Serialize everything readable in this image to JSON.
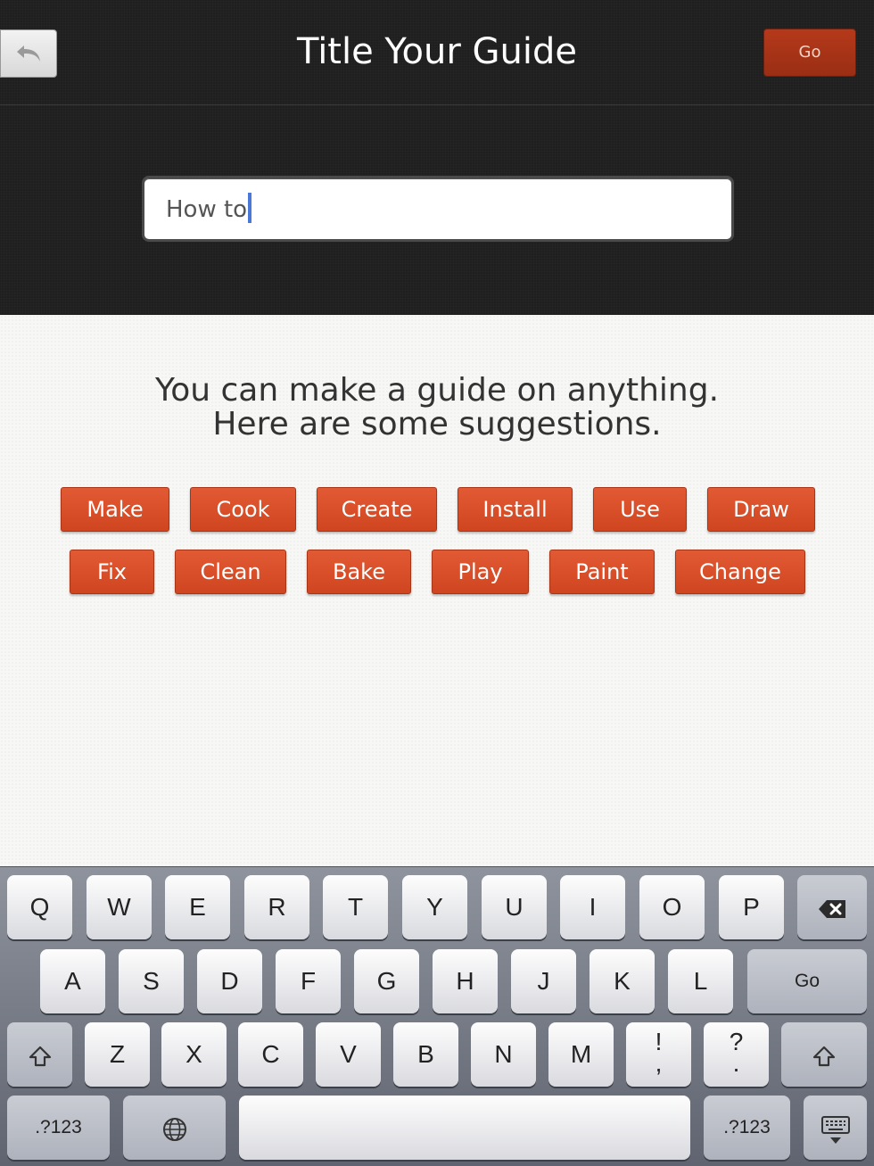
{
  "header": {
    "title": "Title Your Guide",
    "go_label": "Go",
    "back_icon": "undo-arrow-icon"
  },
  "title_input": {
    "value": "How to"
  },
  "content": {
    "intro_line1": "You can make a guide on anything.",
    "intro_line2": "Here are some suggestions.",
    "suggestions_row1": [
      "Make",
      "Cook",
      "Create",
      "Install",
      "Use",
      "Draw"
    ],
    "suggestions_row2": [
      "Fix",
      "Clean",
      "Bake",
      "Play",
      "Paint",
      "Change"
    ]
  },
  "keyboard": {
    "row1": [
      "Q",
      "W",
      "E",
      "R",
      "T",
      "Y",
      "U",
      "I",
      "O",
      "P"
    ],
    "row2": [
      "A",
      "S",
      "D",
      "F",
      "G",
      "H",
      "J",
      "K",
      "L"
    ],
    "row3": [
      "Z",
      "X",
      "C",
      "V",
      "B",
      "N",
      "M"
    ],
    "go_label": "Go",
    "excl_top": "!",
    "excl_bottom": ",",
    "quest_top": "?",
    "quest_bottom": ".",
    "numbers_label": ".?123",
    "icons": {
      "backspace": "backspace-icon",
      "shift": "shift-icon",
      "globe": "globe-icon",
      "dismiss": "keyboard-dismiss-icon"
    }
  },
  "colors": {
    "accent": "#d64b25",
    "header_bg": "#1f1f1f",
    "go_button": "#a8331a",
    "caret": "#4a78d9"
  }
}
